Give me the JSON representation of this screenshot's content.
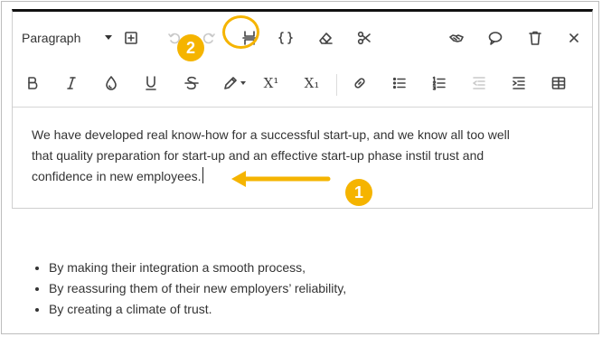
{
  "toolbar": {
    "paragraph_select": "Paragraph",
    "row1_icons": [
      "insert-block-icon",
      "undo-icon",
      "redo-icon",
      "page-break-icon",
      "code-braces-icon",
      "eraser-icon",
      "scissors-icon",
      "accessibility-icon",
      "comment-icon",
      "trash-icon",
      "close-icon"
    ],
    "row2_icons": [
      "bold-icon",
      "italic-icon",
      "color-drop-icon",
      "underline-icon",
      "strikethrough-icon",
      "highlighter-icon",
      "superscript-icon",
      "subscript-icon",
      "link-icon",
      "bullet-list-icon",
      "numbered-list-icon",
      "outdent-icon",
      "indent-icon",
      "table-icon"
    ],
    "superscript_label": "X¹",
    "subscript_label": "X₁"
  },
  "editor": {
    "paragraph_lines": [
      "We have developed real know-how for a successful start-up, and we know all too well",
      "that quality preparation for start-up and an effective start-up phase instil trust and",
      "confidence in new employees."
    ]
  },
  "callouts": {
    "one": "1",
    "two": "2"
  },
  "bullets": [
    "By making their integration a smooth process,",
    "By reassuring them of their new employers’ reliability,",
    "By creating a climate of trust."
  ],
  "colors": {
    "accent": "#f5b400",
    "toolbar_icon": "#444444",
    "disabled_icon": "#c9c9c9",
    "top_bar": "#111111"
  }
}
